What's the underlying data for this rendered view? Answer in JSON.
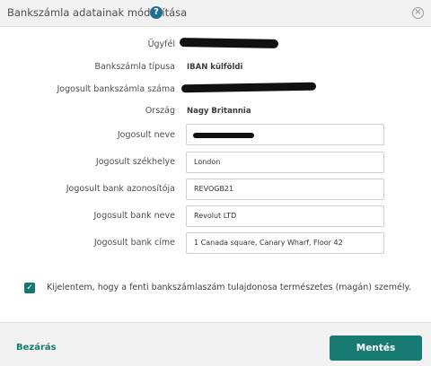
{
  "dialog": {
    "title": "Bankszámla adatainak módosítása",
    "help_icon": "?",
    "close_icon": "×"
  },
  "rows": {
    "client": {
      "label": "Ügyfél"
    },
    "account_type": {
      "label": "Bankszámla típusa",
      "value": "IBAN külföldi"
    },
    "account_number": {
      "label": "Jogosult bankszámla száma"
    },
    "country": {
      "label": "Ország",
      "value": "Nagy Britannia"
    }
  },
  "fields": {
    "name": {
      "label": "Jogosult neve",
      "value": ""
    },
    "seat": {
      "label": "Jogosult székhelye",
      "value": "London"
    },
    "bank_id": {
      "label": "Jogosult bank azonosítója",
      "value": "REVOGB21"
    },
    "bank_name": {
      "label": "Jogosult bank neve",
      "value": "Revolut LTD"
    },
    "bank_address": {
      "label": "Jogosult bank címe",
      "value": "1 Canada square, Canary Wharf, Floor 42"
    }
  },
  "declaration": {
    "checked": true,
    "text": "Kijelentem, hogy a fenti bankszámlaszám tulajdonosa természetes (magán) személy."
  },
  "footer": {
    "close_label": "Bezárás",
    "save_label": "Mentés"
  },
  "colors": {
    "accent": "#177b73",
    "help": "#1f6f94"
  }
}
